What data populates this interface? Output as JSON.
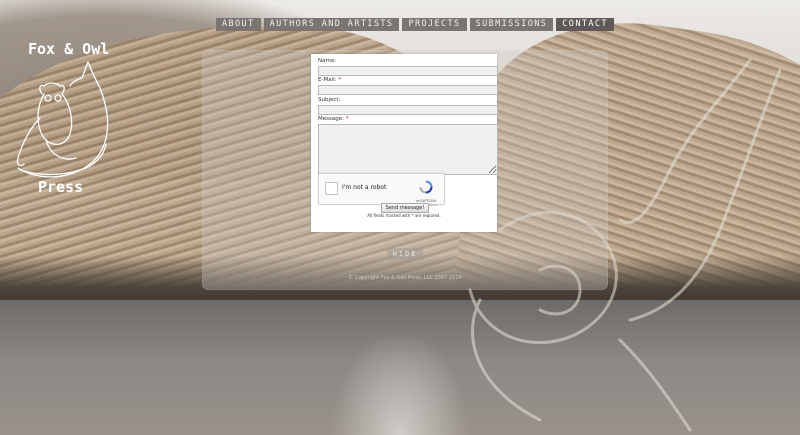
{
  "logo": {
    "title": "Fox & Owl",
    "subtitle": "Press"
  },
  "nav": {
    "items": [
      {
        "label": "ABOUT",
        "active": false
      },
      {
        "label": "AUTHORS AND ARTISTS",
        "active": false
      },
      {
        "label": "PROJECTS",
        "active": false
      },
      {
        "label": "SUBMISSIONS",
        "active": false
      },
      {
        "label": "CONTACT",
        "active": true
      }
    ]
  },
  "form": {
    "name_label": "Name:",
    "email_label": "E-Mail:",
    "subject_label": "Subject:",
    "message_label": "Message:",
    "required_mark": "*",
    "name_value": "",
    "email_value": "",
    "subject_value": "",
    "message_value": "",
    "captcha_label": "I'm not a robot",
    "captcha_brand": "reCAPTCHA",
    "captcha_links": "Privacy - Terms",
    "send_label": "Send message!",
    "note": "All fields marked with * are required."
  },
  "panel": {
    "hide_label": "HIDE",
    "copyright": "© Copyright Fox & Owl Press, LLC 2007-2014"
  },
  "colors": {
    "nav_bg": "#7b7571",
    "nav_active": "#5f5a57",
    "required": "#cc0000"
  }
}
